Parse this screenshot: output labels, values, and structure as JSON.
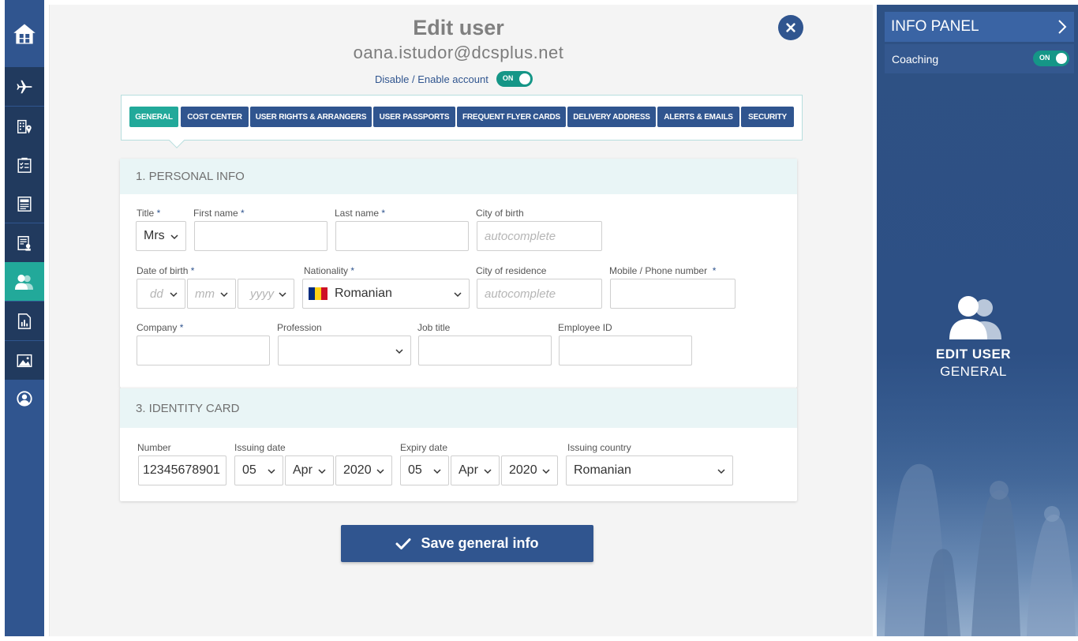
{
  "colors": {
    "brand": "#30558f",
    "accent": "#22a99a",
    "dark_nav": "#213a5e"
  },
  "sidebar": {
    "items": [
      {
        "icon": "home-icon"
      },
      {
        "icon": "flight-icon"
      },
      {
        "icon": "hotel-icon"
      },
      {
        "icon": "checklist-icon"
      },
      {
        "icon": "report-icon"
      },
      {
        "icon": "approval-icon"
      },
      {
        "icon": "users-icon",
        "active": true
      },
      {
        "icon": "statistics-icon"
      },
      {
        "icon": "gallery-icon"
      },
      {
        "icon": "profile-icon"
      }
    ]
  },
  "header": {
    "title": "Edit user",
    "email": "oana.istudor@dcsplus.net",
    "account_toggle_label": "Disable / Enable account",
    "account_toggle_state": "ON"
  },
  "tabs": [
    {
      "label": "GENERAL",
      "active": true
    },
    {
      "label": "COST CENTER"
    },
    {
      "label": "USER RIGHTS & ARRANGERS"
    },
    {
      "label": "USER PASSPORTS"
    },
    {
      "label": "FREQUENT FLYER CARDS"
    },
    {
      "label": "DELIVERY ADDRESS"
    },
    {
      "label": "ALERTS & EMAILS"
    },
    {
      "label": "SECURITY"
    }
  ],
  "personal": {
    "heading": "1. PERSONAL INFO",
    "required_mark": "*",
    "title_label": "Title",
    "title_value": "Mrs",
    "first_name_label": "First name",
    "last_name_label": "Last name",
    "city_birth_label": "City of birth",
    "city_birth_placeholder": "autocomplete",
    "dob_label": "Date of birth",
    "dob_day_placeholder": "dd",
    "dob_month_placeholder": "mm",
    "dob_year_placeholder": "yyyy",
    "nationality_label": "Nationality",
    "nationality_value": "Romanian",
    "city_res_label": "City of residence",
    "city_res_placeholder": "autocomplete",
    "phone_label": "Mobile / Phone number",
    "company_label": "Company",
    "profession_label": "Profession",
    "job_title_label": "Job title",
    "employee_id_label": "Employee ID"
  },
  "identity": {
    "heading": "3. IDENTITY CARD",
    "number_label": "Number",
    "number_value": "12345678901",
    "issuing_date_label": "Issuing date",
    "issue_day": "05",
    "issue_month": "Apr",
    "issue_year": "2020",
    "expiry_date_label": "Expiry date",
    "expiry_day": "05",
    "expiry_month": "Apr",
    "expiry_year": "2020",
    "issuing_country_label": "Issuing country",
    "issuing_country_value": "Romanian"
  },
  "save_label": "Save general info",
  "info_panel": {
    "title": "INFO PANEL",
    "coaching_label": "Coaching",
    "coaching_state": "ON",
    "section_title": "EDIT USER",
    "section_sub": "GENERAL"
  }
}
